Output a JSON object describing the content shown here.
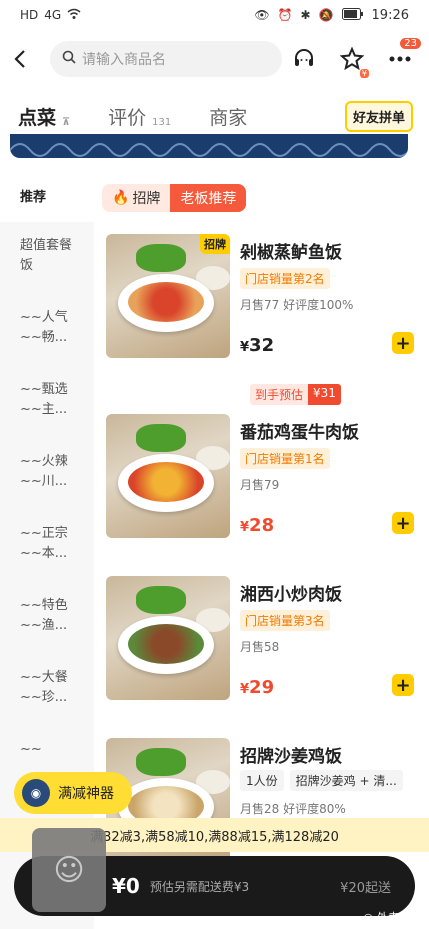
{
  "status": {
    "left_icons": [
      "HD",
      "4G",
      "wifi"
    ],
    "time": "19:26"
  },
  "header": {
    "search_placeholder": "请输入商品名",
    "notification_count": "23",
    "fav_sub": "¥"
  },
  "tabs": [
    {
      "label": "点菜",
      "sub": "⊼"
    },
    {
      "label": "评价",
      "sub": "131"
    },
    {
      "label": "商家",
      "sub": ""
    }
  ],
  "pin_label": "好友拼单",
  "sidebar": [
    "推荐",
    "超值套餐\n饭",
    "~~人气\n~~畅...",
    "~~甄选\n~~主...",
    "~~火辣\n~~川...",
    "~~正宗\n~~本...",
    "~~特色\n~~渔...",
    "~~大餐\n~~珍...",
    "~~"
  ],
  "tag_bar": {
    "signature": "招牌",
    "boss": "老板推荐"
  },
  "dishes": [
    {
      "name": "剁椒蒸鲈鱼饭",
      "badge": "招牌",
      "rank": "门店销量第2名",
      "meta": "月售77  好评度100%",
      "currency": "¥",
      "price": "32",
      "est_label": "到手预估",
      "est_price": "¥31"
    },
    {
      "name": "番茄鸡蛋牛肉饭",
      "badge": "",
      "rank": "门店销量第1名",
      "meta": "月售79",
      "currency": "¥",
      "price": "28"
    },
    {
      "name": "湘西小炒肉饭",
      "badge": "",
      "rank": "门店销量第3名",
      "meta": "月售58",
      "currency": "¥",
      "price": "29"
    },
    {
      "name": "招牌沙姜鸡饭",
      "badge": "",
      "chips": [
        "1人份",
        "招牌沙姜鸡 + 清..."
      ],
      "meta": "月售28  好评度80%"
    }
  ],
  "promo_label": "满减神器",
  "discount_text": "满32减3,满58减10,满88减15,满128减20",
  "cart": {
    "total": "¥0",
    "fee": "预估另需配送费¥3",
    "min_order": "¥20起送"
  },
  "watermark": "外卖玩家"
}
